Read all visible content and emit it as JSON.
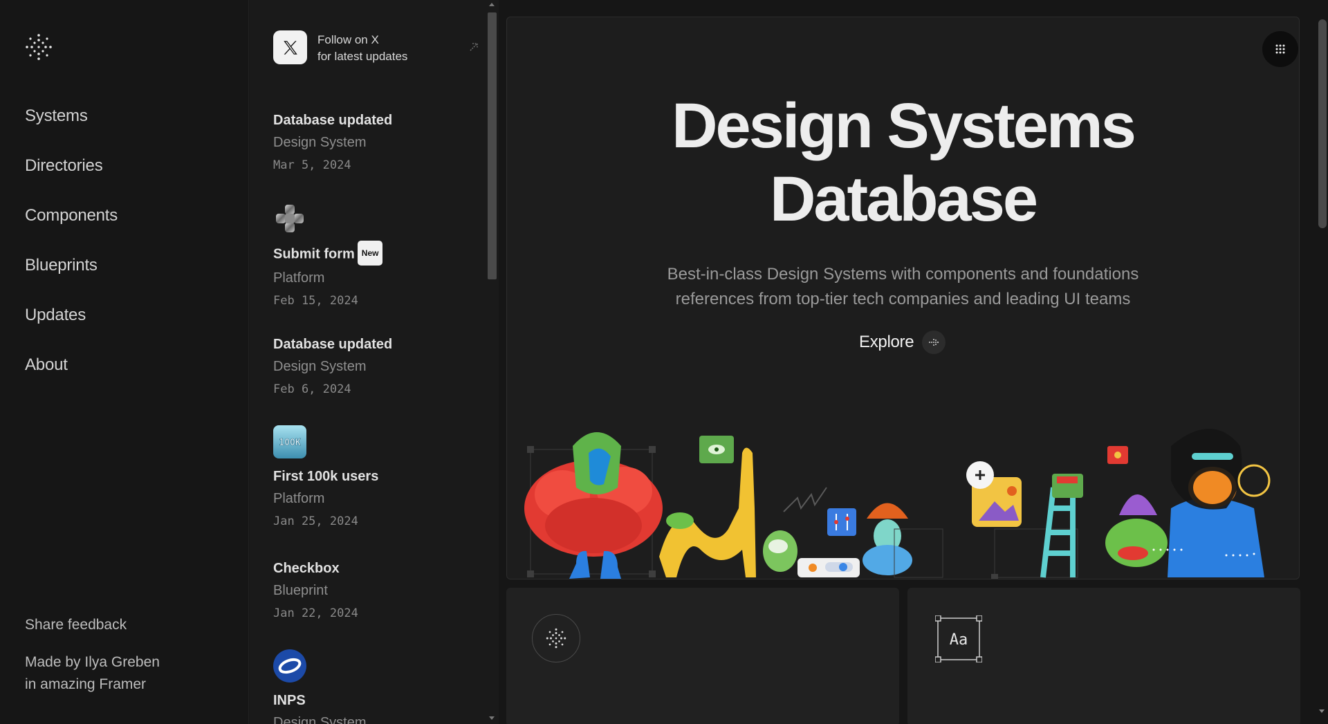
{
  "nav": {
    "items": [
      {
        "label": "Systems"
      },
      {
        "label": "Directories"
      },
      {
        "label": "Components"
      },
      {
        "label": "Blueprints"
      },
      {
        "label": "Updates"
      },
      {
        "label": "About"
      }
    ],
    "feedback": "Share feedback",
    "credit_line1": "Made by Ilya Greben",
    "credit_line2": "in amazing Framer"
  },
  "follow": {
    "line1": "Follow on X",
    "line2": "for latest updates"
  },
  "updates": [
    {
      "title": "Database updated",
      "category": "Design System",
      "date": "Mar 5, 2024"
    },
    {
      "title": "Submit form",
      "badge": "New",
      "category": "Platform",
      "date": "Feb 15, 2024",
      "icon": "form-chrome-icon"
    },
    {
      "title": "Database updated",
      "category": "Design System",
      "date": "Feb 6, 2024"
    },
    {
      "title": "First 100k users",
      "category": "Platform",
      "date": "Jan 25, 2024",
      "icon": "100k-icon",
      "icon_text": "100K"
    },
    {
      "title": "Checkbox",
      "category": "Blueprint",
      "date": "Jan 22, 2024"
    },
    {
      "title": "INPS",
      "category": "Design System",
      "date": "",
      "icon": "inps-logo-icon"
    }
  ],
  "hero": {
    "title_line1": "Design Systems",
    "title_line2": "Database",
    "subtitle_line1": "Best-in-class Design Systems with components and foundations",
    "subtitle_line2": "references from top-tier tech companies and leading UI teams",
    "explore_label": "Explore"
  },
  "cards": {
    "typography_icon_text": "Aa"
  },
  "colors": {
    "background": "#161616",
    "panel": "#1d1d1d",
    "text": "#e6e6e6",
    "muted": "#8f8f8f"
  }
}
